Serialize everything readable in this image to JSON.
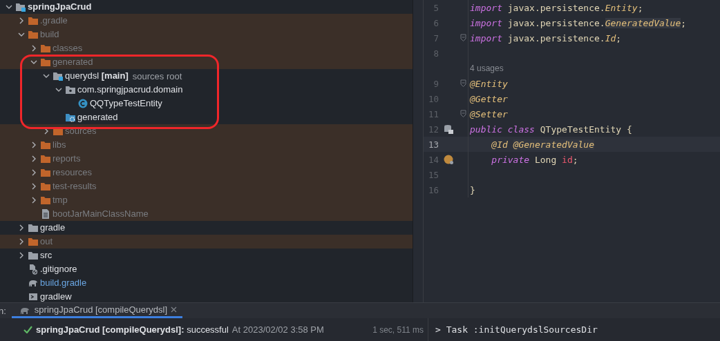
{
  "project_tree": [
    {
      "label": "springJpaCrud",
      "kind": "module",
      "excluded": false,
      "modified": false,
      "expanded": true,
      "children": [
        {
          "label": ".gradle",
          "kind": "folder",
          "excluded": true,
          "modified": false,
          "expanded": false
        },
        {
          "label": "build",
          "kind": "folder",
          "excluded": true,
          "modified": false,
          "expanded": true,
          "children": [
            {
              "label": "classes",
              "kind": "folder",
              "excluded": true,
              "modified": false,
              "expanded": false
            },
            {
              "label": "generated",
              "kind": "folder",
              "excluded": true,
              "modified": false,
              "expanded": true,
              "children": [
                {
                  "label": "querydsl **[main]**",
                  "hint": "sources root",
                  "kind": "source-root",
                  "excluded": false,
                  "modified": false,
                  "expanded": true,
                  "children": [
                    {
                      "label": "com.springjpacrud.domain",
                      "kind": "package",
                      "excluded": false,
                      "modified": false,
                      "expanded": true,
                      "children": [
                        {
                          "label": "QQTypeTestEntity",
                          "kind": "class",
                          "excluded": false,
                          "modified": false
                        }
                      ]
                    },
                    {
                      "label": "generated",
                      "kind": "generated-root",
                      "excluded": false,
                      "modified": false
                    }
                  ]
                },
                {
                  "label": "sources",
                  "kind": "folder",
                  "excluded": true,
                  "modified": false,
                  "expanded": false
                }
              ]
            },
            {
              "label": "libs",
              "kind": "folder",
              "excluded": true,
              "modified": false,
              "expanded": false
            },
            {
              "label": "reports",
              "kind": "folder",
              "excluded": true,
              "modified": false,
              "expanded": false
            },
            {
              "label": "resources",
              "kind": "folder",
              "excluded": true,
              "modified": false,
              "expanded": false
            },
            {
              "label": "test-results",
              "kind": "folder",
              "excluded": true,
              "modified": false,
              "expanded": false
            },
            {
              "label": "tmp",
              "kind": "folder",
              "excluded": true,
              "modified": false,
              "expanded": false
            },
            {
              "label": "bootJarMainClassName",
              "kind": "file",
              "excluded": true,
              "modified": false
            }
          ]
        },
        {
          "label": "gradle",
          "kind": "folder",
          "excluded": false,
          "modified": false,
          "expanded": false
        },
        {
          "label": "out",
          "kind": "folder",
          "excluded": true,
          "modified": false,
          "expanded": false
        },
        {
          "label": "src",
          "kind": "folder",
          "excluded": false,
          "modified": false,
          "expanded": false
        },
        {
          "label": ".gitignore",
          "kind": "ignore-file",
          "excluded": false,
          "modified": false
        },
        {
          "label": "build.gradle",
          "kind": "gradle-file",
          "excluded": false,
          "modified": true
        },
        {
          "label": "gradlew",
          "kind": "script",
          "excluded": false,
          "modified": false
        }
      ]
    }
  ],
  "editor": {
    "lines": [
      {
        "number": "5",
        "kind": "code",
        "current": false,
        "fold": false,
        "tokens": [
          {
            "text": "import",
            "kind": "keyword"
          },
          {
            "text": " javax.persistence.",
            "kind": "plain"
          },
          {
            "text": "Entity",
            "kind": "annotation"
          },
          {
            "text": ";",
            "kind": "plain"
          }
        ]
      },
      {
        "number": "6",
        "kind": "code",
        "current": false,
        "fold": false,
        "tokens": [
          {
            "text": "import",
            "kind": "keyword"
          },
          {
            "text": " javax.persistence.",
            "kind": "plain"
          },
          {
            "text": "GeneratedValue",
            "kind": "annotation-hl"
          },
          {
            "text": ";",
            "kind": "plain"
          }
        ]
      },
      {
        "number": "7",
        "kind": "code",
        "current": false,
        "fold": true,
        "tokens": [
          {
            "text": "import",
            "kind": "keyword"
          },
          {
            "text": " javax.persistence.",
            "kind": "plain"
          },
          {
            "text": "Id",
            "kind": "annotation"
          },
          {
            "text": ";",
            "kind": "plain"
          }
        ]
      },
      {
        "number": "8",
        "kind": "code",
        "current": false,
        "fold": false
      },
      {
        "number": "9",
        "kind": "code",
        "current": false,
        "fold": true,
        "inlay": "4 usages",
        "tokens": [
          {
            "text": "@Entity",
            "kind": "annotation"
          }
        ]
      },
      {
        "number": "10",
        "kind": "code",
        "current": false,
        "fold": false,
        "tokens": [
          {
            "text": "@Getter",
            "kind": "annotation"
          }
        ]
      },
      {
        "number": "11",
        "kind": "code",
        "current": false,
        "fold": true,
        "tokens": [
          {
            "text": "@Setter",
            "kind": "annotation"
          }
        ]
      },
      {
        "number": "12",
        "kind": "database-marker",
        "current": false,
        "fold": false,
        "tokens": [
          {
            "text": "public class",
            "kind": "keyword"
          },
          {
            "text": " QTypeTestEntity {",
            "kind": "plain"
          }
        ]
      },
      {
        "number": "13",
        "kind": "code",
        "current": true,
        "fold": false,
        "tokens": [
          {
            "text": "    @Id ",
            "kind": "annotation"
          },
          {
            "text": "@GeneratedValue",
            "kind": "annotation-hl"
          }
        ]
      },
      {
        "number": "14",
        "kind": "bean-marker",
        "current": false,
        "fold": false,
        "tokens": [
          {
            "text": "    private",
            "kind": "keyword"
          },
          {
            "text": " Long ",
            "kind": "plain"
          },
          {
            "text": "id",
            "kind": "field"
          },
          {
            "text": ";",
            "kind": "plain"
          }
        ]
      },
      {
        "number": "15",
        "kind": "code",
        "current": false,
        "fold": false
      },
      {
        "number": "16",
        "kind": "code",
        "current": false,
        "fold": false,
        "tokens": [
          {
            "text": "}",
            "kind": "plain"
          }
        ]
      }
    ]
  },
  "run_panel": {
    "label": "n:",
    "tabs": [
      {
        "label": "springJpaCrud [compileQuerydsl]",
        "selected": true
      }
    ],
    "result": {
      "text": "**springJpaCrud [compileQuerydsl]:** successful",
      "time": "At 2023/02/02 3:58 PM",
      "duration": "1 sec, 511 ms"
    },
    "console": "> Task :initQuerydslSourcesDir"
  }
}
